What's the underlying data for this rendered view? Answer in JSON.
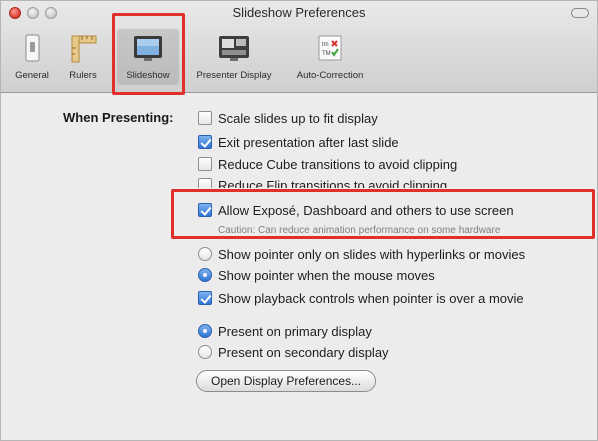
{
  "window": {
    "title": "Slideshow Preferences"
  },
  "toolbar": {
    "items": [
      {
        "label": "General",
        "icon": "general-switch-icon",
        "selected": false
      },
      {
        "label": "Rulers",
        "icon": "ruler-icon",
        "selected": false
      },
      {
        "label": "Slideshow",
        "icon": "slideshow-screen-icon",
        "selected": true
      },
      {
        "label": "Presenter Display",
        "icon": "presenter-display-icon",
        "selected": false
      },
      {
        "label": "Auto-Correction",
        "icon": "auto-correction-icon",
        "selected": false
      }
    ]
  },
  "presenting": {
    "label": "When Presenting:",
    "scale_slides": {
      "label": "Scale slides up to fit display",
      "checked": false
    },
    "exit_presentation": {
      "label": "Exit presentation after last slide",
      "checked": true
    },
    "reduce_cube": {
      "label": "Reduce Cube transitions to avoid clipping",
      "checked": false
    },
    "reduce_flip": {
      "label": "Reduce Flip transitions to avoid clipping",
      "checked": false
    },
    "allow_expose": {
      "label": "Allow Exposé, Dashboard and others to use screen",
      "checked": true
    },
    "caution": "Caution: Can reduce animation performance on some hardware",
    "pointer_hyperlinks": {
      "label": "Show pointer only on slides with hyperlinks or movies",
      "selected": false
    },
    "pointer_mouse": {
      "label": "Show pointer when the mouse moves",
      "selected": true
    },
    "playback_controls": {
      "label": "Show playback controls when pointer is over a movie",
      "checked": true
    },
    "primary_display": {
      "label": "Present on primary display",
      "selected": true
    },
    "secondary_display": {
      "label": "Present on secondary display",
      "selected": false
    },
    "open_display_prefs": "Open Display Preferences..."
  },
  "colors": {
    "highlight": "#e0302b",
    "checkbox_blue": "#2f74d6"
  }
}
